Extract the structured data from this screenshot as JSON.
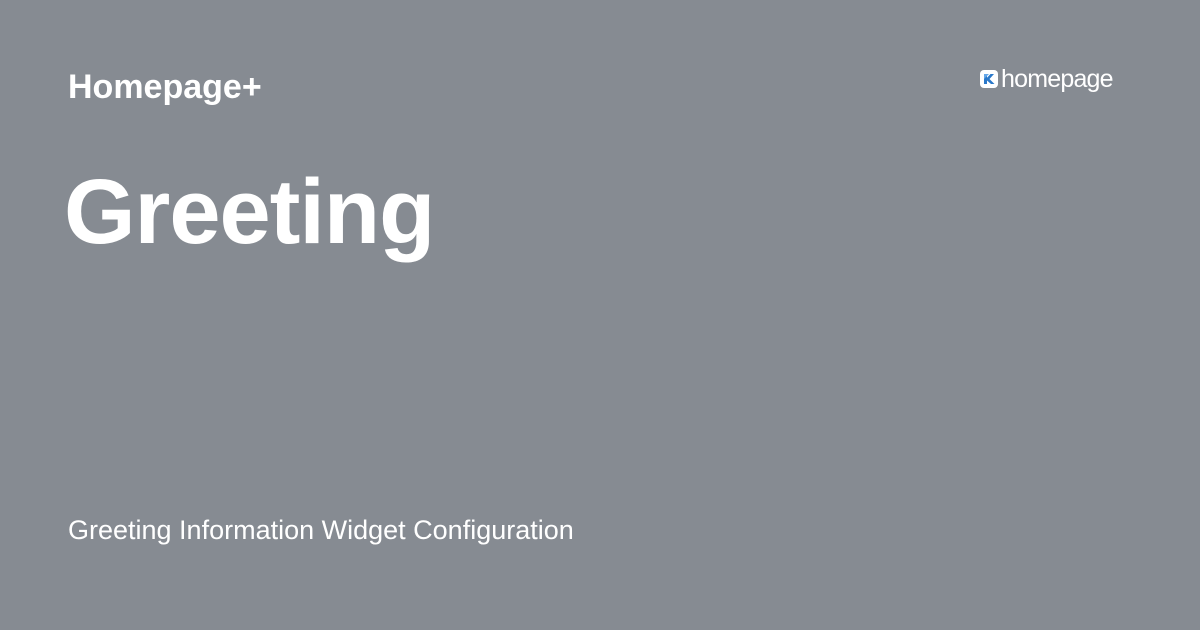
{
  "header": {
    "product_name": "Homepage+",
    "logo": {
      "icon": "homepage-logo-icon",
      "wordmark": "homepage"
    }
  },
  "main": {
    "title": "Greeting",
    "subtitle": "Greeting Information Widget Configuration"
  },
  "colors": {
    "background": "#868b92",
    "text": "#ffffff",
    "logo_accent": "#2a78c9"
  }
}
